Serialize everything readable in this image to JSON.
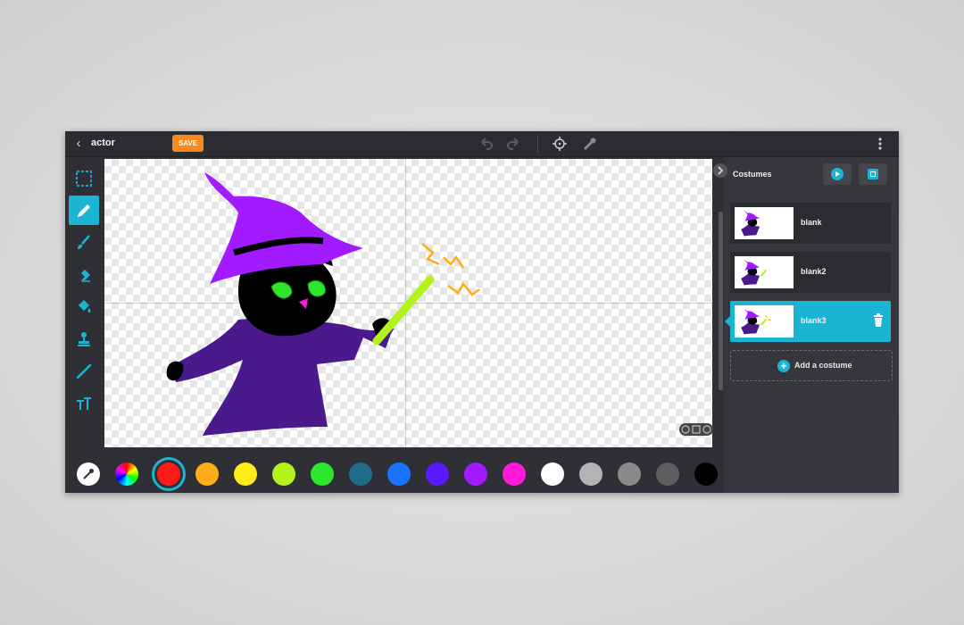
{
  "app": {
    "title": "actor",
    "save_label": "SAVE"
  },
  "toolbar": {
    "icons": [
      "undo-icon",
      "redo-icon",
      "crosshair-icon",
      "eyedropper-icon",
      "more-icon"
    ]
  },
  "tools": [
    {
      "name": "select-tool",
      "icon": "marquee-select-icon",
      "active": false
    },
    {
      "name": "pencil-tool",
      "icon": "pencil-icon",
      "active": true
    },
    {
      "name": "brush-tool",
      "icon": "brush-icon",
      "active": false
    },
    {
      "name": "eraser-tool",
      "icon": "eraser-icon",
      "active": false
    },
    {
      "name": "fill-tool",
      "icon": "paint-bucket-icon",
      "active": false
    },
    {
      "name": "stamp-tool",
      "icon": "stamp-icon",
      "active": false
    },
    {
      "name": "line-tool",
      "icon": "line-icon",
      "active": false
    },
    {
      "name": "text-tool",
      "icon": "text-icon",
      "active": false
    }
  ],
  "palette": {
    "colors": [
      "#ff1a1a",
      "#ffae1a",
      "#ffec1a",
      "#b3f21a",
      "#2ee62e",
      "#1f6b87",
      "#1a73ff",
      "#5a1aff",
      "#a21aff",
      "#ff1ad9",
      "#ffffff",
      "#b3b3b3",
      "#8a8a8a",
      "#5e5e5e",
      "#000000"
    ],
    "selected": "#ff1a1a"
  },
  "panel": {
    "title": "Costumes",
    "costumes": [
      {
        "name": "blank",
        "active": false
      },
      {
        "name": "blank2",
        "active": false
      },
      {
        "name": "blank3",
        "active": true
      }
    ],
    "add_label": "Add a costume"
  },
  "accent": "#1bb4d3"
}
